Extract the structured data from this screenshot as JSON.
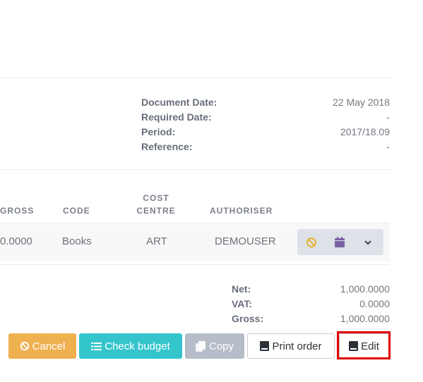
{
  "document": {
    "document_date_label": "Document Date:",
    "document_date_value": "22 May 2018",
    "required_date_label": "Required Date:",
    "required_date_value": "-",
    "period_label": "Period:",
    "period_value": "2017/18.09",
    "reference_label": "Reference:",
    "reference_value": "-"
  },
  "table": {
    "headers": {
      "gross": "GROSS",
      "code": "CODE",
      "cost_centre_line1": "COST",
      "cost_centre_line2": "CENTRE",
      "authoriser": "AUTHORISER"
    },
    "row": {
      "gross": "0.0000",
      "code": "Books",
      "cost_centre": "ART",
      "authoriser": "DEMOUSER"
    },
    "row_actions": [
      "ban-icon",
      "calendar-icon",
      "chevron-down-icon"
    ]
  },
  "totals": {
    "net_label": "Net:",
    "net_value": "1,000.0000",
    "vat_label": "VAT:",
    "vat_value": "0.0000",
    "gross_label": "Gross:",
    "gross_value": "1,000.0000"
  },
  "buttons": {
    "cancel": "Cancel",
    "check_budget": "Check budget",
    "copy": "Copy",
    "print_order": "Print order",
    "edit": "Edit"
  },
  "colors": {
    "cancel": "#efb050",
    "check_budget": "#34c5cc",
    "copy": "#b6bdc8",
    "highlight": "#e00000"
  }
}
